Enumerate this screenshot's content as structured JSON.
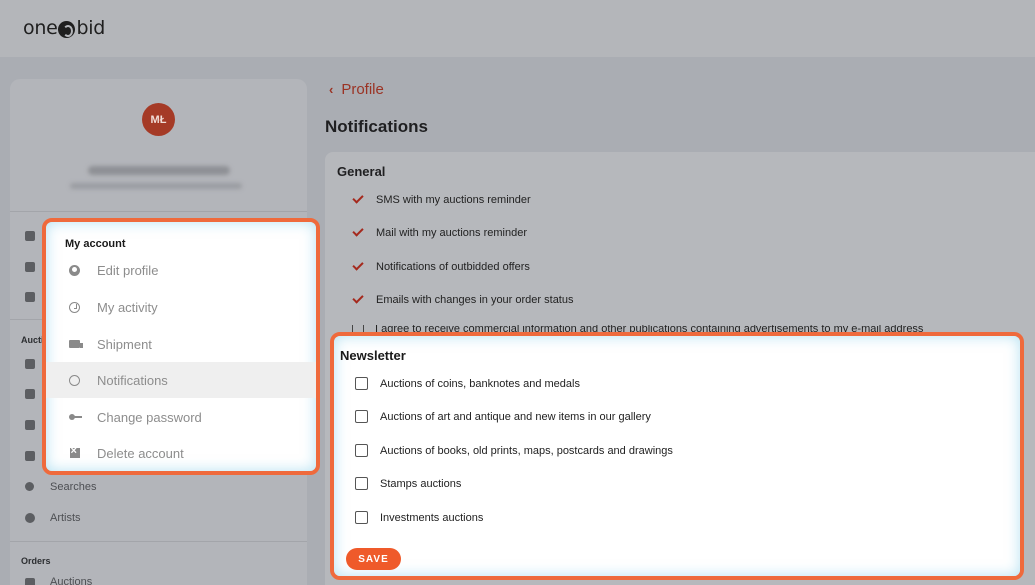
{
  "header": {
    "logo_left": "one",
    "logo_right": "bid"
  },
  "sidebar": {
    "avatar_initials": "MŁ",
    "partial_heading": "Auctio",
    "items_visible": [
      {
        "label": "Searches",
        "icon": "search-icon"
      },
      {
        "label": "Artists",
        "icon": "heart-icon"
      }
    ],
    "orders_heading": "Orders",
    "orders_first_item": "Auctions"
  },
  "breadcrumb": {
    "label": "Profile"
  },
  "page": {
    "title": "Notifications"
  },
  "general": {
    "title": "General",
    "options": [
      {
        "label": "SMS with my auctions reminder",
        "checked": true
      },
      {
        "label": "Mail with my auctions reminder",
        "checked": true
      },
      {
        "label": "Notifications of outbidded offers",
        "checked": true
      },
      {
        "label": "Emails with changes in your order status",
        "checked": true
      }
    ],
    "cut_option": "I agree to receive commercial information and other publications containing advertisements to my e-mail address"
  },
  "account_menu": {
    "title": "My account",
    "items": [
      {
        "label": "Edit profile",
        "icon": "person-icon",
        "active": false
      },
      {
        "label": "My activity",
        "icon": "clock-icon",
        "active": false
      },
      {
        "label": "Shipment",
        "icon": "truck-icon",
        "active": false
      },
      {
        "label": "Notifications",
        "icon": "alarm-icon",
        "active": true
      },
      {
        "label": "Change password",
        "icon": "key-icon",
        "active": false
      },
      {
        "label": "Delete account",
        "icon": "delete-box-icon",
        "active": false
      }
    ]
  },
  "newsletter": {
    "title": "Newsletter",
    "options": [
      {
        "label": "Auctions of coins, banknotes and medals",
        "checked": false
      },
      {
        "label": "Auctions of art and antique and new items in our gallery",
        "checked": false
      },
      {
        "label": "Auctions of books, old prints, maps, postcards and drawings",
        "checked": false
      },
      {
        "label": "Stamps auctions",
        "checked": false
      },
      {
        "label": "Investments auctions",
        "checked": false
      }
    ],
    "save_label": "SAVE"
  },
  "colors": {
    "accent": "#ef5a2a",
    "highlight_border": "#ef6a3c",
    "avatar": "#a53a26"
  }
}
